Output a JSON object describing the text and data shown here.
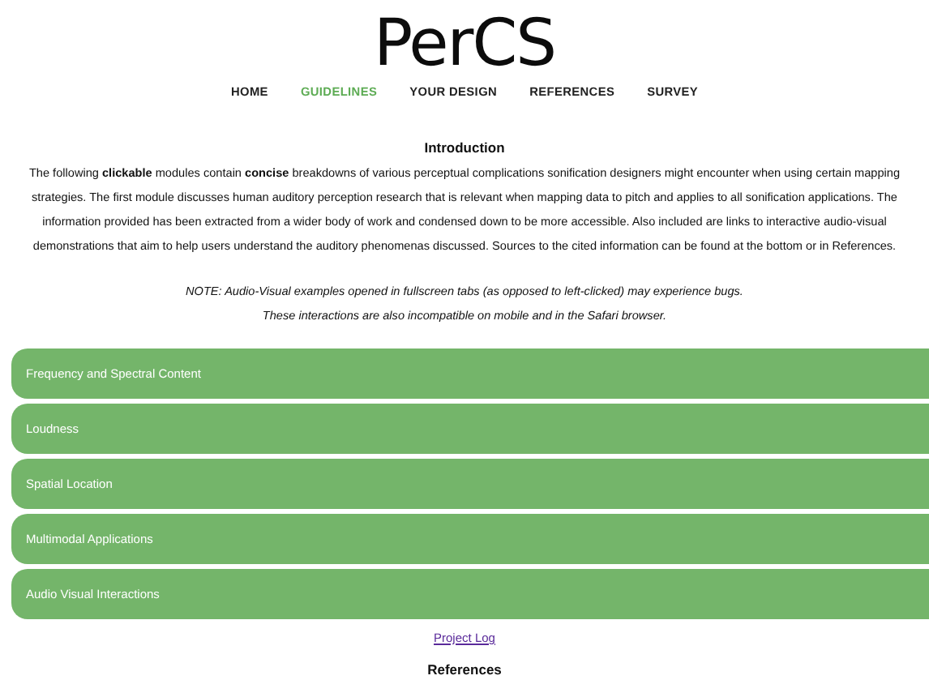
{
  "logo": "PerCS",
  "nav": [
    {
      "label": "HOME",
      "selected": false
    },
    {
      "label": "GUIDELINES",
      "selected": true
    },
    {
      "label": "YOUR DESIGN",
      "selected": false
    },
    {
      "label": "REFERENCES",
      "selected": false
    },
    {
      "label": "SURVEY",
      "selected": false
    }
  ],
  "intro": {
    "heading": "Introduction",
    "paragraph": "The following **clickable** modules contain **concise** breakdowns of various perceptual complications sonification designers might encounter when using certain mapping strategies. The first module discusses human auditory perception research that is relevant when mapping data to pitch and applies to all sonification applications. The information provided has been extracted from a wider body of work and condensed down to be more accessible. Also included are links to interactive audio-visual demonstrations that aim to help users understand the auditory phenomenas discussed. Sources to the cited information can be found at the bottom or in References.",
    "note": [
      "NOTE: Audio-Visual examples opened in fullscreen tabs (as opposed to left-clicked) may experience bugs.",
      "These interactions are also incompatible on mobile and in the Safari browser."
    ]
  },
  "modules": [
    {
      "label": "Frequency and Spectral Content"
    },
    {
      "label": "Loudness"
    },
    {
      "label": "Spatial Location"
    },
    {
      "label": "Multimodal Applications"
    },
    {
      "label": "Audio Visual Interactions"
    }
  ],
  "project_log_link": "Project Log",
  "references_heading": "References"
}
